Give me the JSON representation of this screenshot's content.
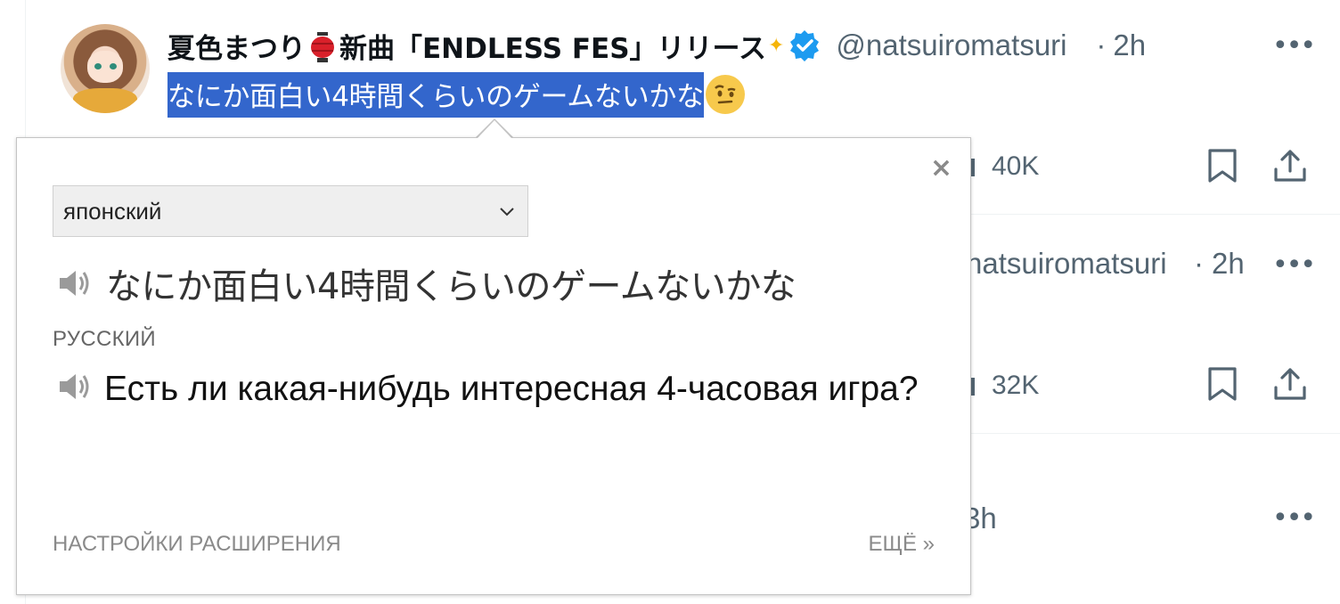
{
  "tweet": {
    "display_name": "夏色まつり",
    "display_name_suffix": "新曲「ENDLESS FES」リリース",
    "handle": "@natsuiromatsuri",
    "separator": "·",
    "time": "2h",
    "more": "•••",
    "selected_text": "なにか面白い4時間くらいのゲームないかな",
    "views": "40K"
  },
  "background": {
    "second_tweet": {
      "handle": "natsuiromatsuri",
      "time": "2h",
      "views": "32K",
      "more": "•••"
    },
    "third_tweet": {
      "time_fragment": "3h",
      "more": "•••"
    }
  },
  "popup": {
    "close_label": "×",
    "source_language": "японский",
    "source_text": "なにか面白い4時間くらいのゲームないかな",
    "target_language_label": "РУССКИЙ",
    "translation": "Есть ли какая-нибудь интересная 4-часовая игра?",
    "settings_link": "НАСТРОЙКИ РАСШИРЕНИЯ",
    "more_link": "ЕЩЁ »"
  }
}
